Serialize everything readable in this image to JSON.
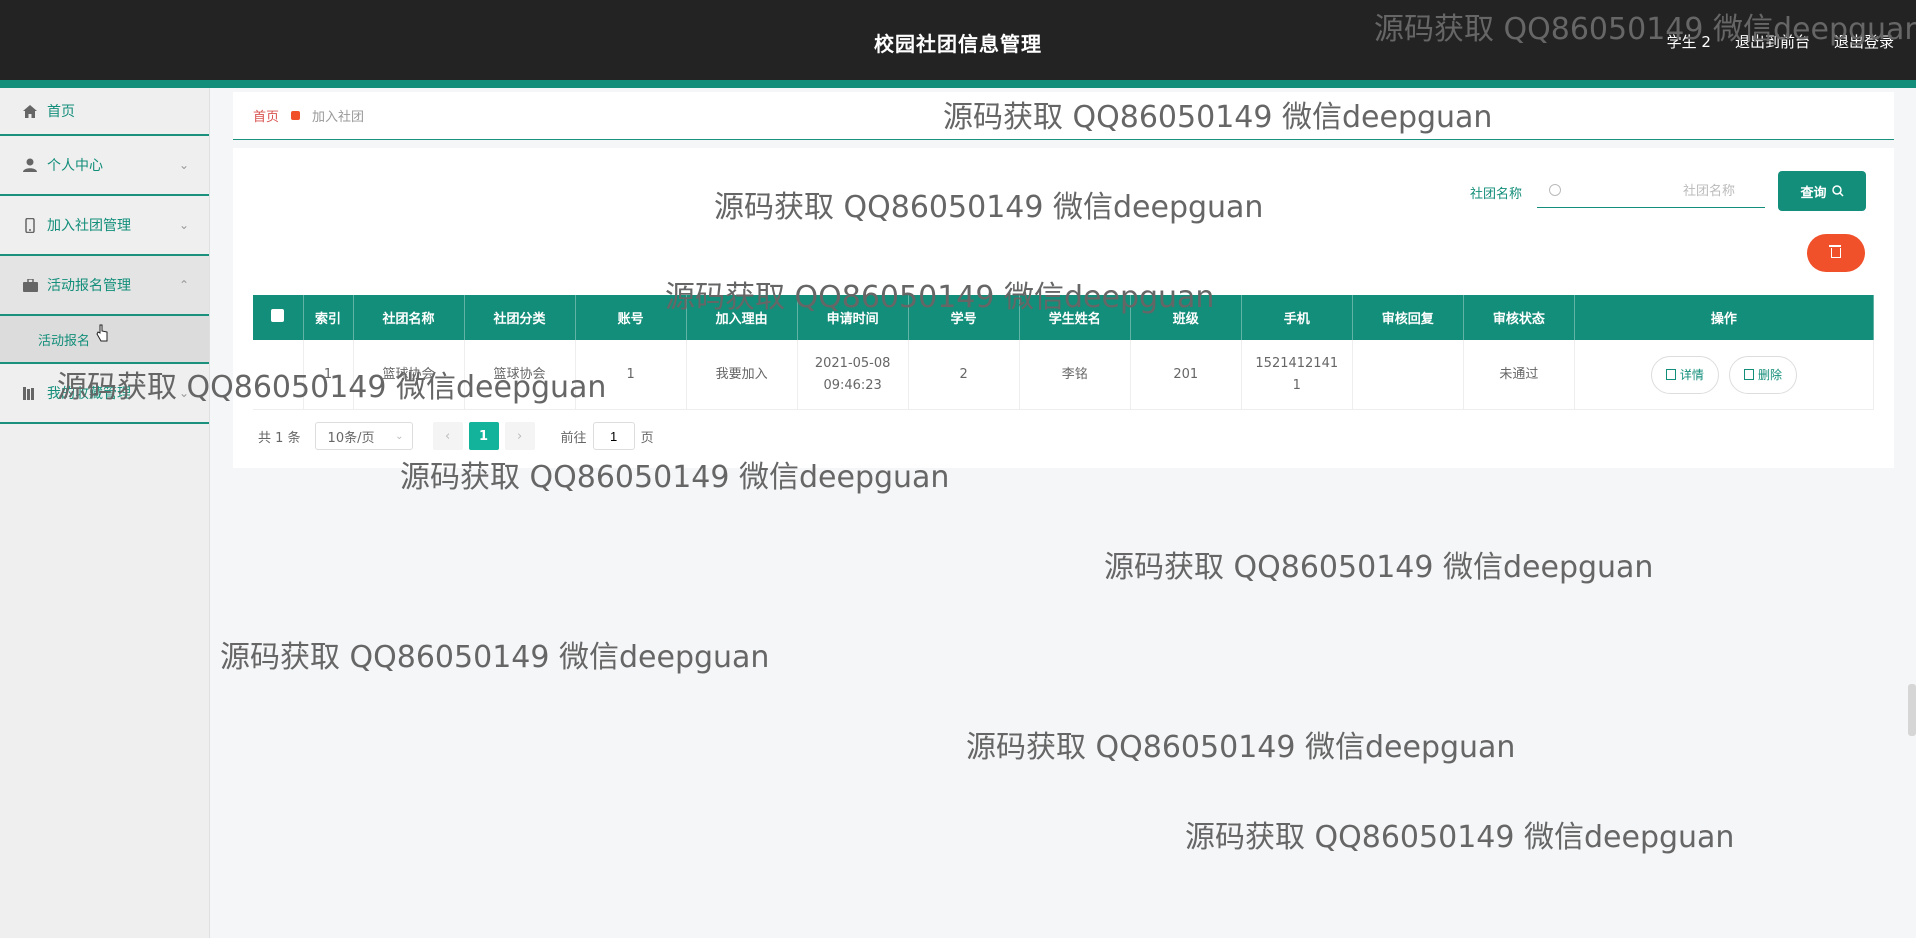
{
  "header": {
    "app_title": "校园社团信息管理",
    "user": "学生 2",
    "nav": [
      "退出到前台",
      "退出登录"
    ]
  },
  "sidebar": {
    "items": [
      {
        "label": "首页",
        "icon": "home-icon"
      },
      {
        "label": "个人中心",
        "icon": "user-icon"
      },
      {
        "label": "加入社团管理",
        "icon": "phone-icon"
      },
      {
        "label": "活动报名管理",
        "icon": "briefcase-icon",
        "expanded": true
      },
      {
        "label": "我的收藏管理",
        "icon": "library-icon"
      }
    ],
    "sub_item": "活动报名"
  },
  "breadcrumb": {
    "home": "首页",
    "current": "加入社团"
  },
  "search": {
    "label": "社团名称",
    "placeholder": "社团名称",
    "button": "查询"
  },
  "table": {
    "columns": [
      "索引",
      "社团名称",
      "社团分类",
      "账号",
      "加入理由",
      "申请时间",
      "学号",
      "学生姓名",
      "班级",
      "手机",
      "审核回复",
      "审核状态",
      "操作"
    ],
    "rows": [
      {
        "index": "1",
        "club": "篮球协会",
        "category": "篮球协会",
        "account": "1",
        "reason": "我要加入",
        "date": "2021-05-08",
        "time": "09:46:23",
        "student_no": "2",
        "name": "李铭",
        "class": "201",
        "phone_1": "1521412141",
        "phone_2": "1",
        "reply": "",
        "status": "未通过",
        "detail_btn": "详情",
        "delete_btn": "删除"
      }
    ]
  },
  "pager": {
    "total": "共 1 条",
    "page_size": "10条/页",
    "current": "1",
    "goto_label": "前往",
    "goto_value": "1",
    "page_unit": "页"
  },
  "watermark": "源码获取 QQ86050149 微信deepguan",
  "colors": {
    "primary": "#138e7a",
    "danger": "#f0512b",
    "header": "#232323"
  }
}
